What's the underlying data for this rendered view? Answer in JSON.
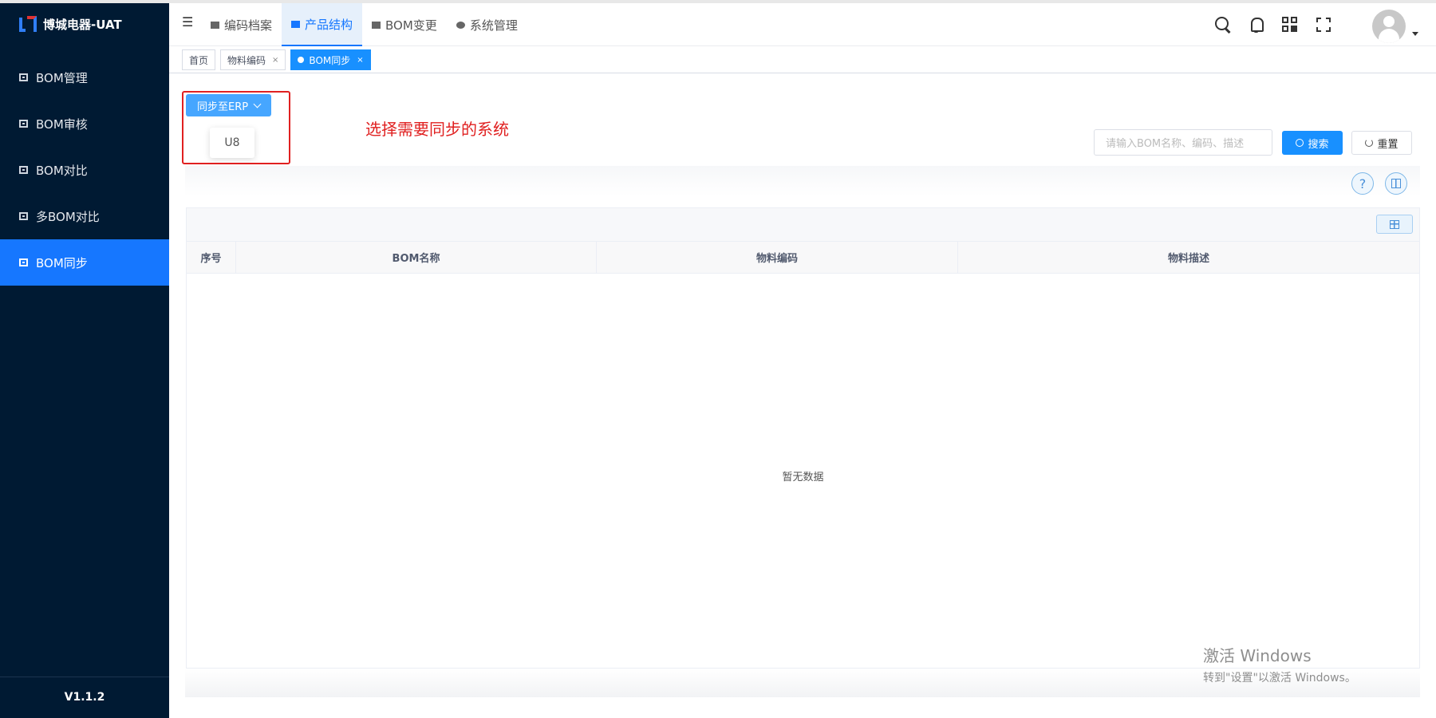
{
  "app": {
    "title": "博城电器-UAT",
    "version": "V1.1.2"
  },
  "sidebar": {
    "items": [
      {
        "label": "BOM管理",
        "icon": "folder-icon",
        "active": false
      },
      {
        "label": "BOM审核",
        "icon": "folder-icon",
        "active": false
      },
      {
        "label": "BOM对比",
        "icon": "folder-icon",
        "active": false
      },
      {
        "label": "多BOM对比",
        "icon": "folder-icon",
        "active": false
      },
      {
        "label": "BOM同步",
        "icon": "folder-icon",
        "active": true
      }
    ]
  },
  "header": {
    "collapse_icon": "menu-fold-icon",
    "nav": [
      {
        "label": "编码档案",
        "icon": "folder-icon",
        "active": false
      },
      {
        "label": "产品结构",
        "icon": "layers-icon",
        "active": true
      },
      {
        "label": "BOM变更",
        "icon": "chart-icon",
        "active": false
      },
      {
        "label": "系统管理",
        "icon": "gear-icon",
        "active": false
      }
    ],
    "icons": [
      "search-icon",
      "bell-icon",
      "qrcode-icon",
      "fullscreen-icon"
    ]
  },
  "tabs": [
    {
      "label": "首页",
      "closable": false,
      "active": false
    },
    {
      "label": "物料编码",
      "closable": true,
      "active": false
    },
    {
      "label": "BOM同步",
      "closable": true,
      "active": true
    }
  ],
  "toolbar": {
    "sync_label": "同步至ERP",
    "dropdown_option": "U8",
    "annotation": "选择需要同步的系统",
    "search_placeholder": "请输入BOM名称、编码、描述",
    "search_label": "搜索",
    "reset_label": "重置",
    "help_glyph": "?"
  },
  "table": {
    "columns": [
      "序号",
      "BOM名称",
      "物料编码",
      "物料描述"
    ],
    "empty_text": "暂无数据"
  },
  "watermark": {
    "line1": "激活 Windows",
    "line2": "转到\"设置\"以激活 Windows。"
  },
  "colors": {
    "sidebar_bg": "#001a33",
    "accent": "#1677ff",
    "annotation": "#e02020"
  }
}
